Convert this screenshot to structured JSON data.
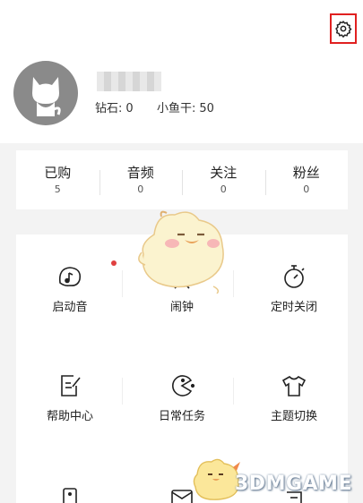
{
  "profile": {
    "diamond_label": "钻石:",
    "diamond_value": "0",
    "fish_label": "小鱼干:",
    "fish_value": "50"
  },
  "counts": [
    {
      "label": "已购",
      "value": "5"
    },
    {
      "label": "音频",
      "value": "0"
    },
    {
      "label": "关注",
      "value": "0"
    },
    {
      "label": "粉丝",
      "value": "0"
    }
  ],
  "menu": [
    {
      "label": "启动音",
      "icon": "music-note-icon"
    },
    {
      "label": "闹钟",
      "icon": "alarm-clock-icon"
    },
    {
      "label": "定时关闭",
      "icon": "stopwatch-icon"
    },
    {
      "label": "帮助中心",
      "icon": "help-note-icon"
    },
    {
      "label": "日常任务",
      "icon": "pacman-icon"
    },
    {
      "label": "主题切换",
      "icon": "tshirt-icon"
    }
  ],
  "watermark": "3DMGAME",
  "colors": {
    "highlight_border": "#e02020",
    "notification_dot": "#e04040",
    "avatar_bg": "#8a8a8a"
  }
}
